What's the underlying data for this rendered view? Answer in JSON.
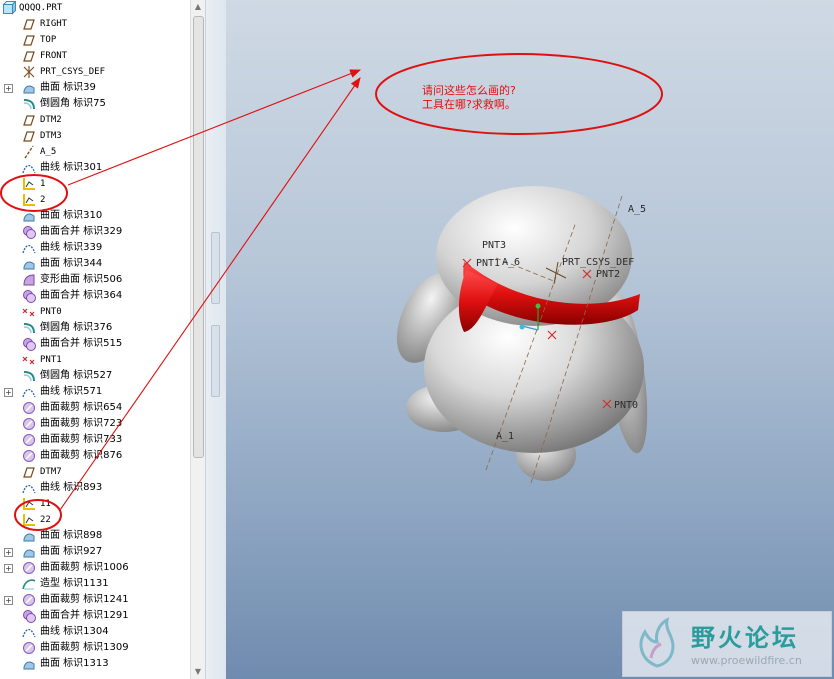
{
  "tree": {
    "root_label": "QQQQ.PRT",
    "items": [
      {
        "label": "RIGHT",
        "icon": "datum-plane-icon",
        "mono": true
      },
      {
        "label": "TOP",
        "icon": "datum-plane-icon",
        "mono": true
      },
      {
        "label": "FRONT",
        "icon": "datum-plane-icon",
        "mono": true
      },
      {
        "label": "PRT_CSYS_DEF",
        "icon": "coordinate-system-icon",
        "mono": true
      },
      {
        "label": "曲面 标识39",
        "icon": "surface-icon",
        "expand": true
      },
      {
        "label": "倒圆角 标识75",
        "icon": "round-icon"
      },
      {
        "label": "DTM2",
        "icon": "datum-plane-icon",
        "mono": true
      },
      {
        "label": "DTM3",
        "icon": "datum-plane-icon",
        "mono": true
      },
      {
        "label": "A_5",
        "icon": "datum-axis-icon",
        "mono": true
      },
      {
        "label": "曲线 标识301",
        "icon": "curve-icon"
      },
      {
        "label": "1",
        "icon": "sketch-icon",
        "mono": true
      },
      {
        "label": "2",
        "icon": "sketch-icon",
        "mono": true
      },
      {
        "label": "曲面 标识310",
        "icon": "surface-icon"
      },
      {
        "label": "曲面合并 标识329",
        "icon": "merge-icon"
      },
      {
        "label": "曲线 标识339",
        "icon": "curve-icon"
      },
      {
        "label": "曲面 标识344",
        "icon": "surface-icon"
      },
      {
        "label": "变形曲面 标识506",
        "icon": "warp-icon"
      },
      {
        "label": "曲面合并 标识364",
        "icon": "merge-icon"
      },
      {
        "label": "PNT0",
        "icon": "datum-point-icon",
        "mono": true
      },
      {
        "label": "倒圆角 标识376",
        "icon": "round-icon"
      },
      {
        "label": "曲面合并 标识515",
        "icon": "merge-icon"
      },
      {
        "label": "PNT1",
        "icon": "datum-point-icon",
        "mono": true
      },
      {
        "label": "倒圆角 标识527",
        "icon": "round-icon"
      },
      {
        "label": "曲线 标识571",
        "icon": "curve-icon",
        "expand": true
      },
      {
        "label": "曲面裁剪 标识654",
        "icon": "trim-icon"
      },
      {
        "label": "曲面裁剪 标识723",
        "icon": "trim-icon"
      },
      {
        "label": "曲面裁剪 标识733",
        "icon": "trim-icon"
      },
      {
        "label": "曲面裁剪 标识876",
        "icon": "trim-icon"
      },
      {
        "label": "DTM7",
        "icon": "datum-plane-icon",
        "mono": true
      },
      {
        "label": "曲线 标识893",
        "icon": "curve-icon"
      },
      {
        "label": "11",
        "icon": "sketch-icon",
        "mono": true
      },
      {
        "label": "22",
        "icon": "sketch-icon",
        "mono": true
      },
      {
        "label": "曲面 标识898",
        "icon": "surface-icon"
      },
      {
        "label": "曲面 标识927",
        "icon": "surface-icon",
        "expand": true
      },
      {
        "label": "曲面裁剪 标识1006",
        "icon": "trim-icon",
        "expand": true
      },
      {
        "label": "造型 标识1131",
        "icon": "style-icon"
      },
      {
        "label": "曲面裁剪 标识1241",
        "icon": "trim-icon",
        "expand": true
      },
      {
        "label": "曲面合并 标识1291",
        "icon": "merge-icon"
      },
      {
        "label": "曲线 标识1304",
        "icon": "curve-icon"
      },
      {
        "label": "曲面裁剪 标识1309",
        "icon": "trim-icon"
      },
      {
        "label": "曲面 标识1313",
        "icon": "surface-icon"
      }
    ]
  },
  "model_labels": {
    "axis_a5": "A_5",
    "axis_a6": "A_6",
    "axis_a1": "A_1",
    "pnt3": "PNT3",
    "pnt1": "PNT1",
    "pnt2": "PNT2",
    "pnt0": "PNT0",
    "csys": "PRT_CSYS_DEF"
  },
  "annotation": {
    "line1": "请问这些怎么画的?",
    "line2": "工具在哪?求救啊。",
    "color": "#e01010"
  },
  "watermark": {
    "title": "野火论坛",
    "url": "www.proewildfire.cn"
  },
  "colors": {
    "scarf": "#e01010",
    "viewport_top": "#cfd9e4",
    "viewport_bottom": "#6f8bae"
  }
}
